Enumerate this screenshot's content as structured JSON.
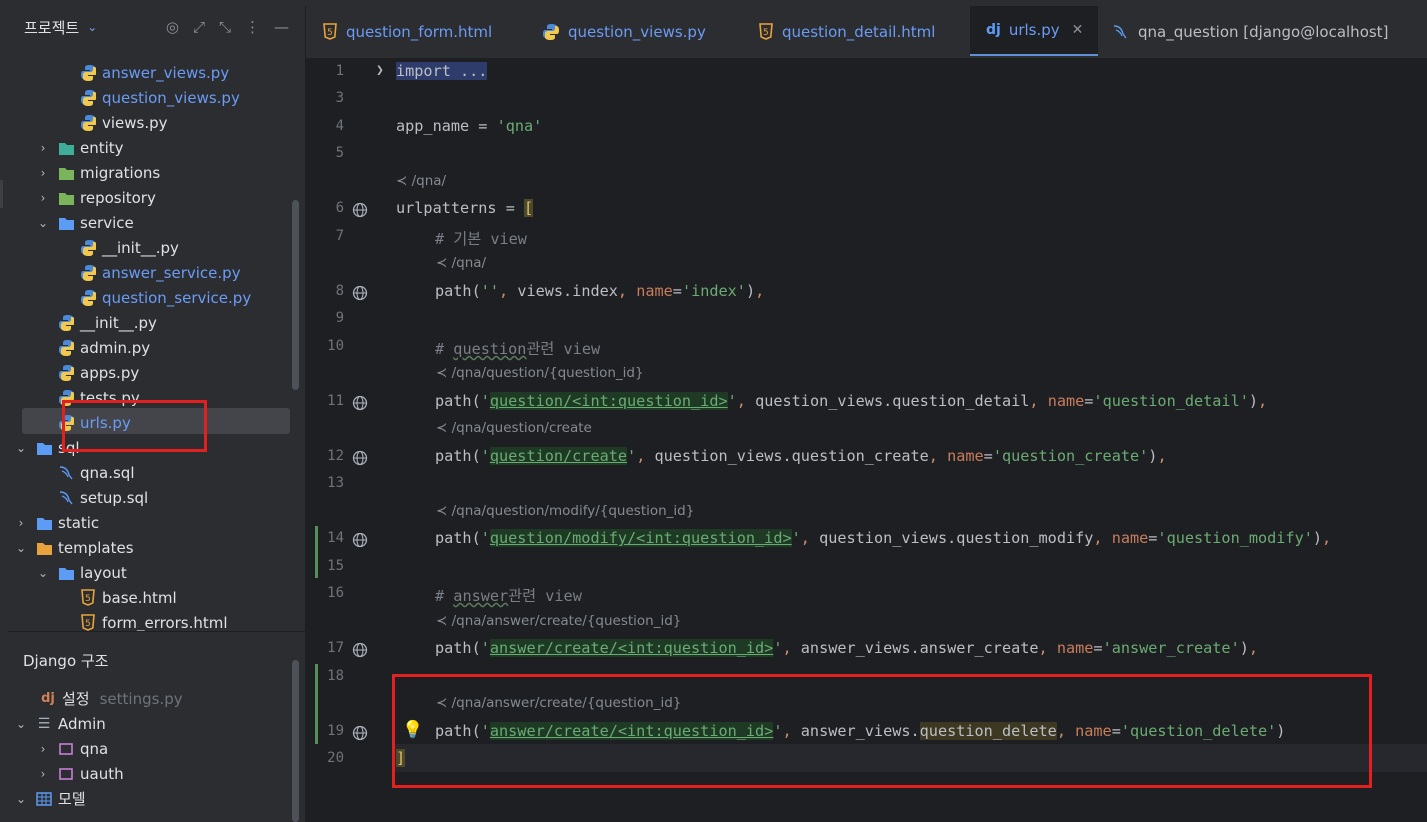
{
  "sidebar": {
    "title": "프로젝트",
    "tree": [
      {
        "label": "answer_views.py",
        "type": "py",
        "level": 3,
        "color": "blue"
      },
      {
        "label": "question_views.py",
        "type": "py",
        "level": 3,
        "color": "blue"
      },
      {
        "label": "views.py",
        "type": "py",
        "level": 3,
        "color": "plain"
      },
      {
        "label": "entity",
        "type": "folder-entity",
        "level": 2,
        "color": "plain"
      },
      {
        "label": "migrations",
        "type": "folder-db",
        "level": 2,
        "color": "plain"
      },
      {
        "label": "repository",
        "type": "folder-db",
        "level": 2,
        "color": "plain"
      },
      {
        "label": "service",
        "type": "folder-service",
        "level": 2,
        "color": "plain"
      },
      {
        "label": "__init__.py",
        "type": "py",
        "level": 3,
        "color": "plain"
      },
      {
        "label": "answer_service.py",
        "type": "py",
        "level": 3,
        "color": "blue"
      },
      {
        "label": "question_service.py",
        "type": "py",
        "level": 3,
        "color": "blue"
      },
      {
        "label": "__init__.py",
        "type": "py",
        "level": 2,
        "color": "plain"
      },
      {
        "label": "admin.py",
        "type": "py",
        "level": 2,
        "color": "plain"
      },
      {
        "label": "apps.py",
        "type": "py",
        "level": 2,
        "color": "plain"
      },
      {
        "label": "tests.py",
        "type": "py",
        "level": 2,
        "color": "plain"
      },
      {
        "label": "urls.py",
        "type": "py",
        "level": 2,
        "color": "blue"
      },
      {
        "label": "sql",
        "type": "folder",
        "level": 1,
        "color": "plain"
      },
      {
        "label": "qna.sql",
        "type": "sql",
        "level": 2,
        "color": "plain"
      },
      {
        "label": "setup.sql",
        "type": "sql",
        "level": 2,
        "color": "plain"
      },
      {
        "label": "static",
        "type": "folder-web",
        "level": 1,
        "color": "plain"
      },
      {
        "label": "templates",
        "type": "folder-tpl",
        "level": 1,
        "color": "plain"
      },
      {
        "label": "layout",
        "type": "folder-layout",
        "level": 2,
        "color": "plain"
      },
      {
        "label": "base.html",
        "type": "html",
        "level": 3,
        "color": "plain"
      },
      {
        "label": "form_errors.html",
        "type": "html",
        "level": 3,
        "color": "plain"
      }
    ],
    "django": {
      "title": "Django 구조",
      "settings_label": "설정",
      "settings_file": "settings.py",
      "admin_label": "Admin",
      "admin_items": [
        "qna",
        "uauth"
      ],
      "models_label": "모델"
    }
  },
  "tabs": [
    {
      "label": "question_form.html",
      "icon": "html-icon"
    },
    {
      "label": "question_views.py",
      "icon": "python-icon"
    },
    {
      "label": "question_detail.html",
      "icon": "html-icon"
    },
    {
      "label": "urls.py",
      "icon": "django-icon",
      "active": true
    },
    {
      "label": "qna_question [django@localhost]",
      "icon": "sql-table-icon"
    }
  ],
  "editor": {
    "line_numbers": [
      "1",
      "3",
      "4",
      "5",
      "6",
      "7",
      "8",
      "9",
      "10",
      "11",
      "12",
      "13",
      "14",
      "15",
      "16",
      "17",
      "18",
      "19",
      "20"
    ],
    "hints": {
      "h6": "/qna/",
      "h8": "/qna/",
      "h11": "/qna/question/{question_id}",
      "h12": "/qna/question/create",
      "h14": "/qna/question/modify/{question_id}",
      "h17": "/qna/answer/create/{question_id}",
      "h19": "/qna/answer/create/{question_id}"
    },
    "lines": {
      "l1": "import ...",
      "l4_var": "app_name = ",
      "l4_str": "'qna'",
      "l6_var": "urlpatterns = ",
      "l6_br": "[",
      "l7": "# 기본 view",
      "l10_a": "# ",
      "l10_b": "question",
      "l10_c": "관련 view",
      "l16_a": "# ",
      "l16_b": "answer",
      "l16_c": "관련 view",
      "l20": "]"
    }
  },
  "colors": {
    "accent": "#5f8fd6",
    "highlight_box": "#e32020",
    "string": "#6aab73",
    "keyword_param": "#c77d5c"
  }
}
